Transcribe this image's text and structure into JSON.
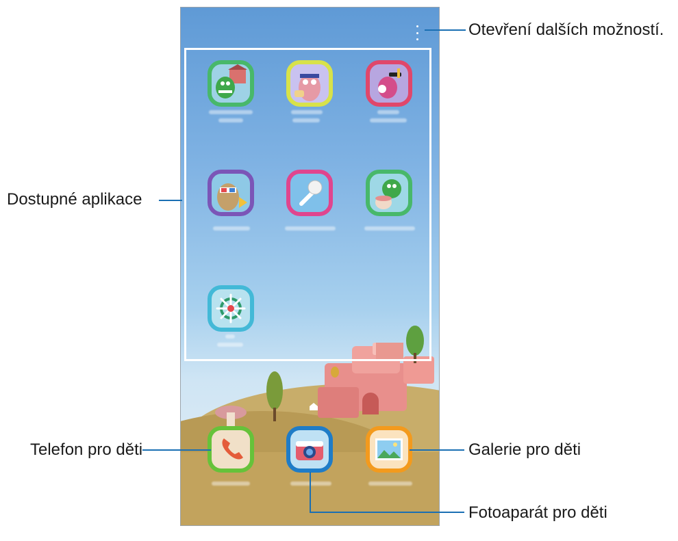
{
  "callouts": {
    "more_options": "Otevření dalších možností.",
    "available_apps": "Dostupné aplikace",
    "kids_phone": "Telefon pro děti",
    "kids_gallery": "Galerie pro děti",
    "kids_camera": "Fotoaparát pro děti"
  },
  "colors": {
    "callout_line": "#1a6fb3",
    "sky_top": "#5f9ad6",
    "hill": "#b89a55"
  },
  "apps": [
    {
      "icon": "crocro-village-icon",
      "border": "#48b86a"
    },
    {
      "icon": "bobby-canvas-icon",
      "border": "#d8e24a"
    },
    {
      "icon": "music-band-icon",
      "border": "#e0476b"
    },
    {
      "icon": "cookie-video-icon",
      "border": "#7b55b7"
    },
    {
      "icon": "magic-voice-icon",
      "border": "#e0458e"
    },
    {
      "icon": "crocro-adventure-icon",
      "border": "#48b86a"
    },
    {
      "icon": "kids-browser-icon",
      "border": "#43b9d7"
    }
  ],
  "dock": [
    {
      "icon": "phone-icon",
      "border": "#66c23a"
    },
    {
      "icon": "camera-icon",
      "border": "#1f7cc7"
    },
    {
      "icon": "gallery-icon",
      "border": "#f39a1d"
    }
  ]
}
